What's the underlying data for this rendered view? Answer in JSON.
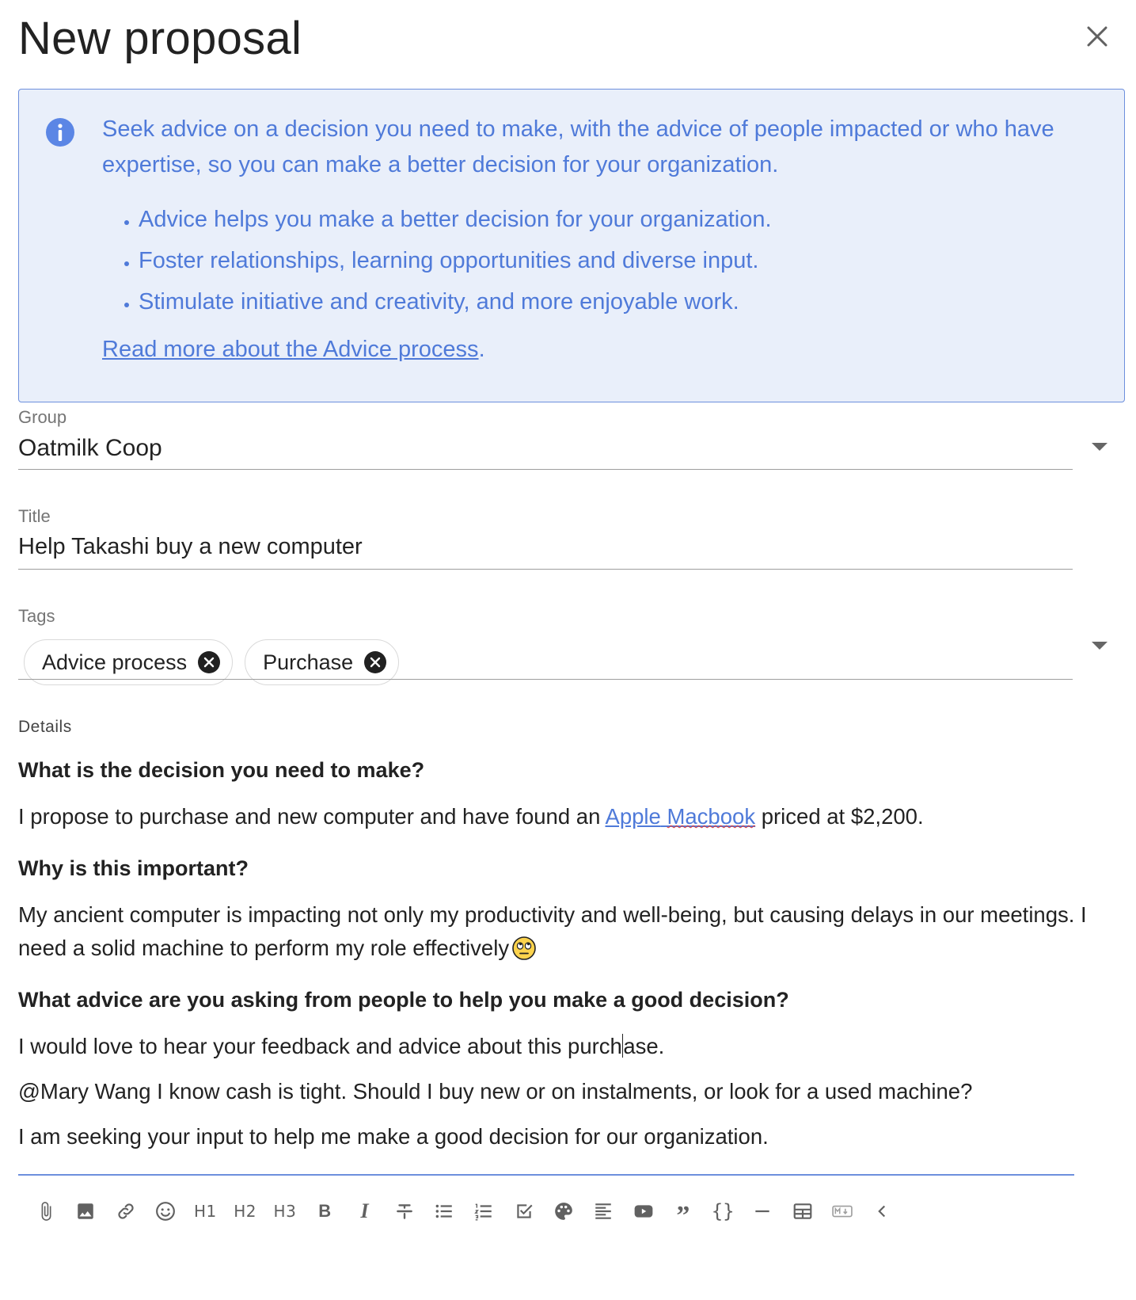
{
  "dialog": {
    "title": "New proposal"
  },
  "info": {
    "intro": "Seek advice on a decision you need to make, with the advice of people impacted or who have expertise, so you can make a better decision for your organization.",
    "bullets": [
      "Advice helps you make a better decision for your organization.",
      "Foster relationships, learning opportunities and diverse input.",
      "Stimulate initiative and creativity, and more enjoyable work."
    ],
    "link_text": "Read more about the Advice process",
    "link_suffix": ".",
    "accent_color": "#4f7ad9",
    "background_color": "#e9effa"
  },
  "group": {
    "label": "Group",
    "value": "Oatmilk Coop"
  },
  "title_field": {
    "label": "Title",
    "value": "Help Takashi buy a new computer"
  },
  "tags": {
    "label": "Tags",
    "items": [
      "Advice process",
      "Purchase"
    ]
  },
  "details": {
    "label": "Details",
    "q1": "What is the decision you need to make?",
    "a1_before": "I propose to purchase and new computer and have found an ",
    "a1_link_word1": "Apple",
    "a1_link_space": " ",
    "a1_link_word2": "Macbook",
    "a1_after": " priced at $2,200.",
    "q2": "Why is this important?",
    "a2": "My ancient computer is impacting not only my productivity and well-being, but causing delays in our meetings. I need a solid machine to perform my role effectively",
    "q3": "What advice are you asking from people to help you make a good decision?",
    "a3_before_caret": "I would love to hear your feedback and advice about this purch",
    "a3_after_caret": "ase.",
    "a4": "@Mary Wang I know cash is tight. Should I buy new or on instalments, or look for a used machine?",
    "a5": "I am seeking your input to help me make a good decision for our organization."
  },
  "toolbar": {
    "h1": "H1",
    "h2": "H2",
    "h3": "H3",
    "bold": "B",
    "italic": "I",
    "quote": "”",
    "code": "{}",
    "markdown": "M↓",
    "items": [
      "attachment-icon",
      "image-icon",
      "link-icon",
      "emoji-icon",
      "heading-1",
      "heading-2",
      "heading-3",
      "bold",
      "italic",
      "strikethrough",
      "bullet-list",
      "numbered-list",
      "task-list",
      "palette-icon",
      "align-icon",
      "video-icon",
      "quote",
      "code-block",
      "horizontal-rule",
      "table-icon",
      "markdown-icon",
      "collapse-icon"
    ]
  }
}
